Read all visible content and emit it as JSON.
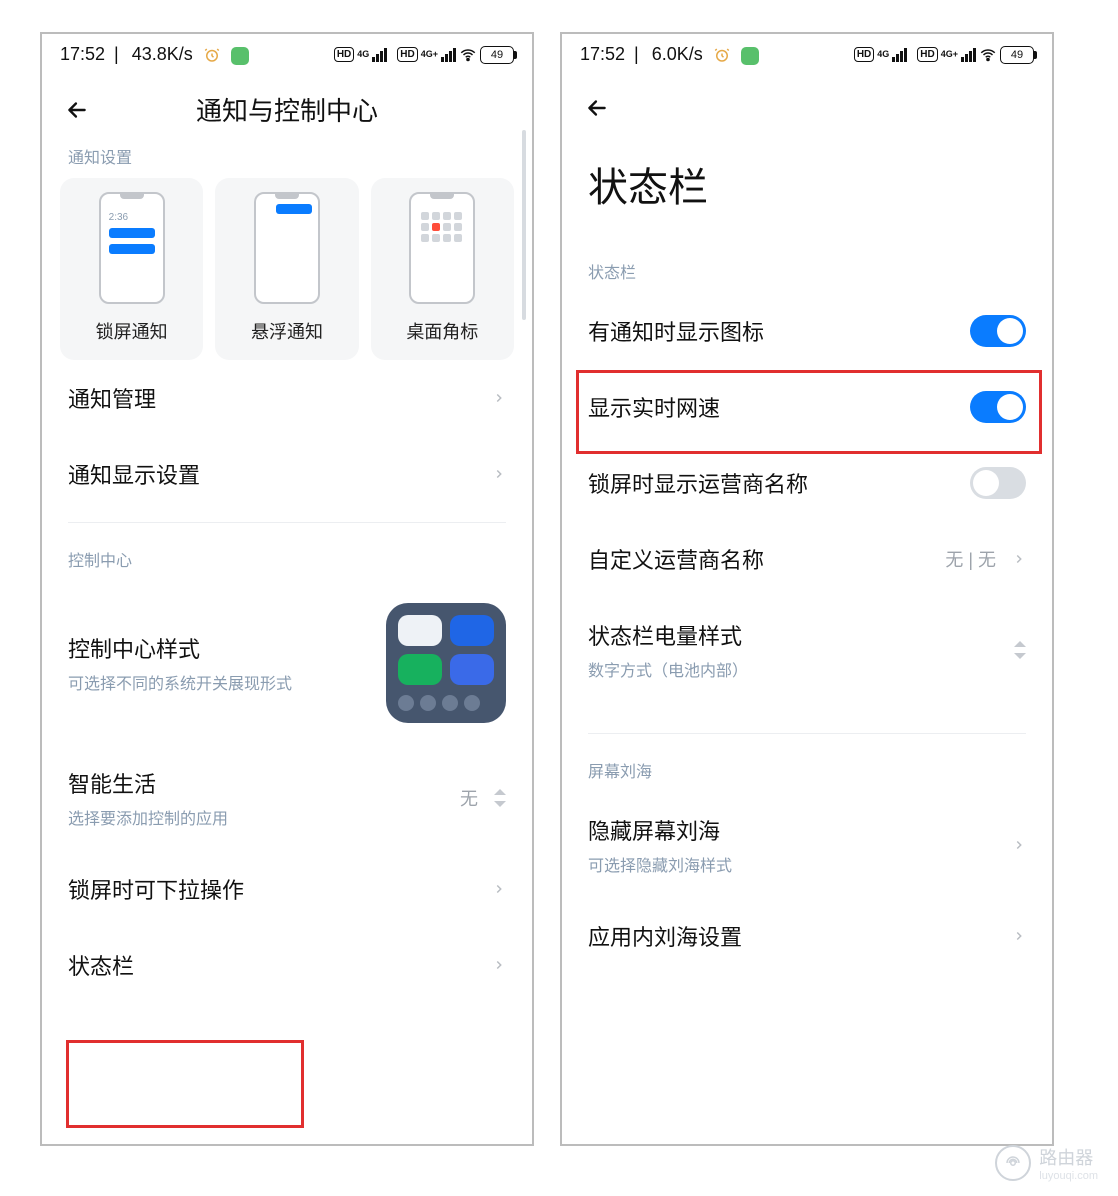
{
  "left": {
    "statusbar": {
      "time": "17:52",
      "netspeed": "43.8K/s",
      "battery": "49"
    },
    "header": {
      "title": "通知与控制中心"
    },
    "section_notify_label": "通知设置",
    "cards": {
      "lockscreen": "锁屏通知",
      "floating": "悬浮通知",
      "badge": "桌面角标",
      "minitime": "2:36"
    },
    "rows": {
      "notify_manage": "通知管理",
      "notify_display": "通知显示设置"
    },
    "section_cc_label": "控制中心",
    "cc_style": {
      "title": "控制中心样式",
      "sub": "可选择不同的系统开关展现形式"
    },
    "smart_life": {
      "title": "智能生活",
      "sub": "选择要添加控制的应用",
      "value": "无"
    },
    "lockpull": "锁屏时可下拉操作",
    "statusbar_row": "状态栏"
  },
  "right": {
    "statusbar": {
      "time": "17:52",
      "netspeed": "6.0K/s",
      "battery": "49"
    },
    "big_title": "状态栏",
    "section_sb_label": "状态栏",
    "rows": {
      "show_icon": "有通知时显示图标",
      "show_netspeed": "显示实时网速",
      "show_carrier": "锁屏时显示运营商名称",
      "custom_carrier": "自定义运营商名称",
      "custom_carrier_value": "无 | 无",
      "batt_style": "状态栏电量样式",
      "batt_style_sub": "数字方式（电池内部）"
    },
    "section_notch_label": "屏幕刘海",
    "notch_rows": {
      "hide": "隐藏屏幕刘海",
      "hide_sub": "可选择隐藏刘海样式",
      "app": "应用内刘海设置"
    }
  },
  "watermark": {
    "text": "路由器",
    "sub": "luyouqi.com"
  }
}
